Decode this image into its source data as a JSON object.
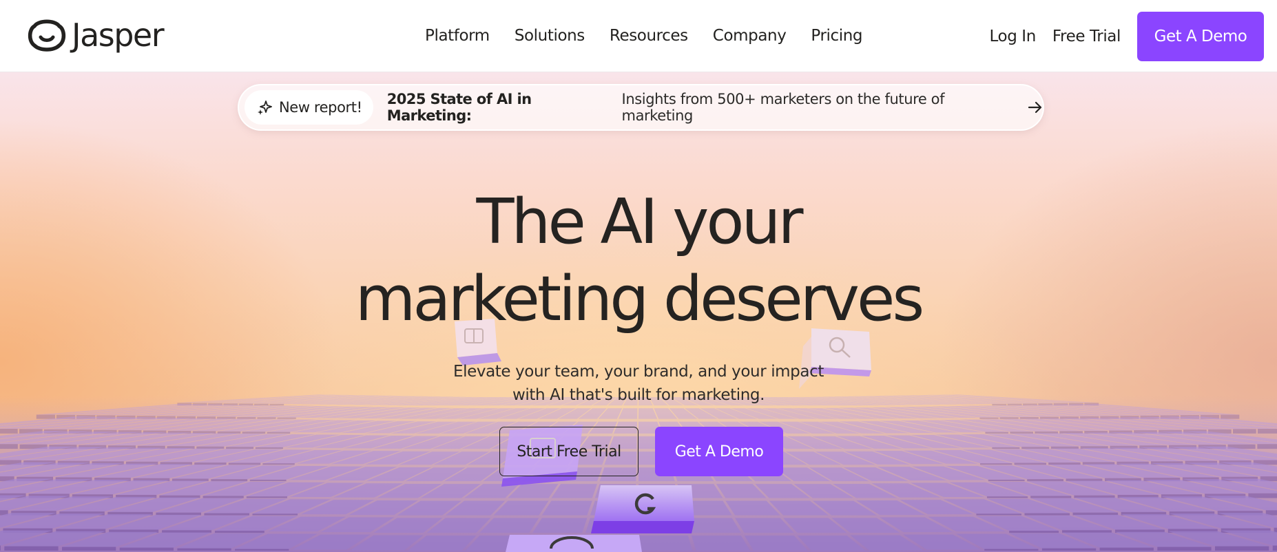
{
  "brand": {
    "name": "Jasper",
    "logo_icon": "jasper-face-logo"
  },
  "nav": {
    "items": [
      {
        "label": "Platform"
      },
      {
        "label": "Solutions"
      },
      {
        "label": "Resources"
      },
      {
        "label": "Company"
      },
      {
        "label": "Pricing"
      }
    ]
  },
  "header_actions": {
    "login": "Log In",
    "free_trial": "Free Trial",
    "demo": "Get A Demo"
  },
  "banner": {
    "tag_icon": "sparkle-icon",
    "tag": "New report!",
    "bold": "2025 State of AI in Marketing:",
    "text": "Insights from 500+ marketers on the future of marketing",
    "arrow_icon": "arrow-right-icon"
  },
  "hero": {
    "headline_line1": "The AI your",
    "headline_line2": "marketing deserves",
    "subtitle_line1": "Elevate your team, your brand, and your impact",
    "subtitle_line2": "with AI that's built for marketing.",
    "cta_secondary": "Start Free Trial",
    "cta_primary": "Get A Demo",
    "floating_icons": [
      "layout-icon",
      "search-icon",
      "image-icon",
      "google-icon",
      "globe-icon"
    ]
  },
  "colors": {
    "accent": "#8b45ff",
    "text": "#232220",
    "tile": "#8e6fbd"
  }
}
